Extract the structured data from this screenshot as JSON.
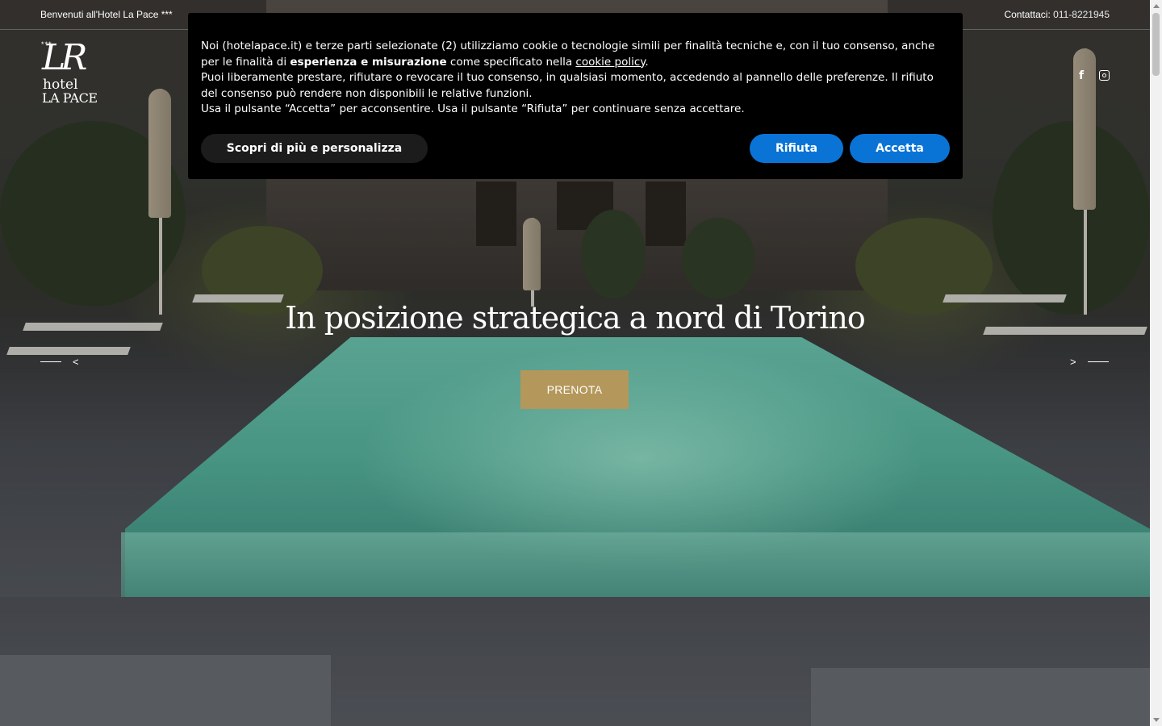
{
  "topbar": {
    "welcome": "Benvenuti all'Hotel La Pace ***",
    "contact_label": "Contattaci:",
    "contact_phone": "011-8221945"
  },
  "logo": {
    "stars": "***",
    "monogram": "LR",
    "line1": "hotel",
    "line2": "LA PACE"
  },
  "social": {
    "facebook_icon": "facebook-icon",
    "instagram_icon": "instagram-icon",
    "facebook_glyph": "f"
  },
  "hero": {
    "headline": "In posizione strategica a nord di Torino",
    "cta": "PRENOTA",
    "prev": "<",
    "next": ">"
  },
  "cookie_banner": {
    "text_intro": "Noi (hotelapace.it) e terze parti selezionate (2) utilizziamo cookie o tecnologie simili per finalità tecniche e, con il tuo consenso, anche per le finalità di ",
    "text_bold": "esperienza e misurazione",
    "text_mid": " come specificato nella ",
    "link": "cookie policy",
    "text_end": ".",
    "line2": "Puoi liberamente prestare, rifiutare o revocare il tuo consenso, in qualsiasi momento, accedendo al pannello delle preferenze. Il rifiuto del consenso può rendere non disponibili le relative funzioni.",
    "line3": "Usa il pulsante “Accetta” per acconsentire. Usa il pulsante “Rifiuta” per continuare senza accettare.",
    "btn_more": "Scopri di più e personalizza",
    "btn_reject": "Rifiuta",
    "btn_accept": "Accetta",
    "accent_color": "#0a74d6"
  },
  "colors": {
    "cta_gold": "#b4975a",
    "banner_bg": "#000000"
  }
}
